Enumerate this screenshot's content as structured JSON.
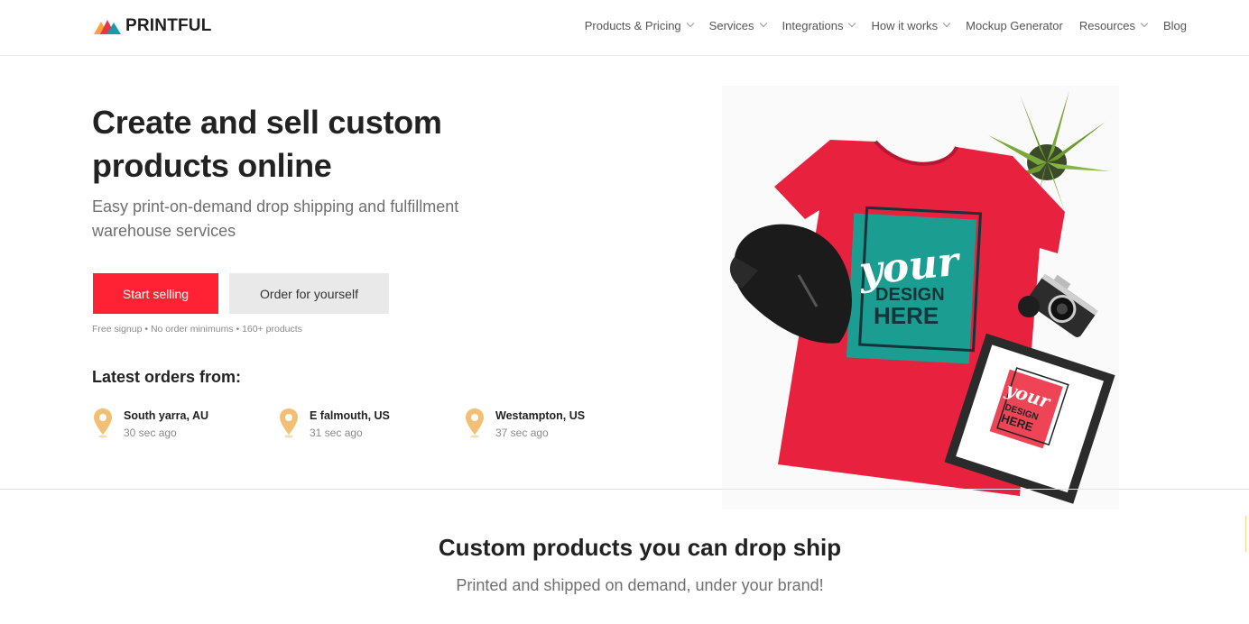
{
  "brand": {
    "name": "PRINTFUL",
    "icon": "mountain-logo-icon"
  },
  "nav": {
    "items": [
      {
        "label": "Products & Pricing",
        "dropdown": true
      },
      {
        "label": "Services",
        "dropdown": true
      },
      {
        "label": "Integrations",
        "dropdown": true
      },
      {
        "label": "How it works",
        "dropdown": true
      },
      {
        "label": "Mockup Generator",
        "dropdown": false
      },
      {
        "label": "Resources",
        "dropdown": true
      },
      {
        "label": "Blog",
        "dropdown": false
      }
    ]
  },
  "hero": {
    "title_line1": "Create and sell custom",
    "title_line2": "products online",
    "subtitle": "Easy print-on-demand drop shipping and fulfillment warehouse services",
    "primary_button": "Start selling",
    "secondary_button": "Order for yourself",
    "perks": "Free signup • No order minimums • 160+ products",
    "shirt_text_line1": "your",
    "shirt_text_line2": "DESIGN",
    "shirt_text_line3": "HERE"
  },
  "latest_orders": {
    "title": "Latest orders from:",
    "orders": [
      {
        "location": "South yarra, AU",
        "time": "30 sec ago"
      },
      {
        "location": "E falmouth, US",
        "time": "31 sec ago"
      },
      {
        "location": "Westampton, US",
        "time": "37 sec ago"
      }
    ]
  },
  "section": {
    "title": "Custom products you can drop ship",
    "subtitle": "Printed and shipped on demand, under your brand!"
  },
  "colors": {
    "accent": "#ff2235",
    "secondary_button": "#e9e9e9",
    "pin": "#f2c074",
    "shirt": "#e8213f",
    "print": "#1c9d92"
  }
}
